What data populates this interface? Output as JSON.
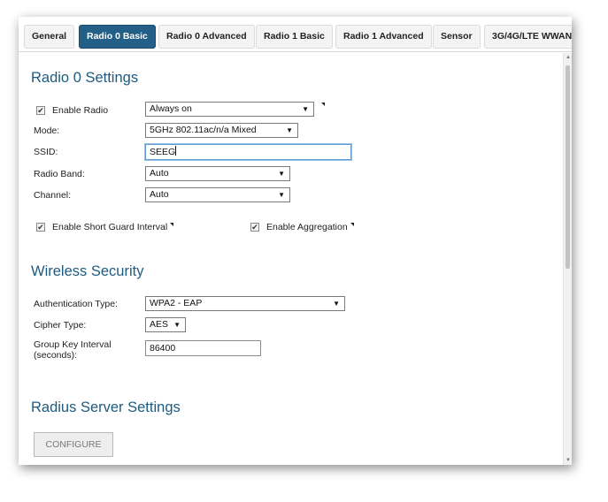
{
  "tabs": [
    {
      "label": "General"
    },
    {
      "label": "Radio 0 Basic",
      "active": true
    },
    {
      "label": "Radio 0 Advanced"
    },
    {
      "label": "Radio 1 Basic"
    },
    {
      "label": "Radio 1 Advanced"
    },
    {
      "label": "Sensor"
    },
    {
      "label": "3G/4G/LTE WWAN"
    }
  ],
  "radio0": {
    "title": "Radio 0 Settings",
    "enable_radio": {
      "label": "Enable Radio",
      "checked": true,
      "value": "Always on"
    },
    "mode": {
      "label": "Mode:",
      "value": "5GHz 802.11ac/n/a Mixed"
    },
    "ssid": {
      "label": "SSID:",
      "value": "SEEG"
    },
    "radio_band": {
      "label": "Radio Band:",
      "value": "Auto"
    },
    "channel": {
      "label": "Channel:",
      "value": "Auto"
    },
    "short_guard": {
      "label": "Enable Short Guard Interval",
      "checked": true
    },
    "aggregation": {
      "label": "Enable Aggregation",
      "checked": true
    }
  },
  "security": {
    "title": "Wireless Security",
    "auth_type": {
      "label": "Authentication Type:",
      "value": "WPA2 - EAP"
    },
    "cipher_type": {
      "label": "Cipher Type:",
      "value": "AES"
    },
    "group_key": {
      "label_line1": "Group Key Interval",
      "label_line2": "(seconds):",
      "value": "86400"
    }
  },
  "radius": {
    "title": "Radius Server Settings",
    "configure_label": "CONFIGURE"
  },
  "glyphs": {
    "dropdown_arrow": "▼",
    "check": "✔",
    "scroll_up": "▲",
    "scroll_down": "▼"
  },
  "colors": {
    "accent": "#235f86",
    "section_title": "#1d5b80",
    "focus": "#5b9bd5"
  }
}
